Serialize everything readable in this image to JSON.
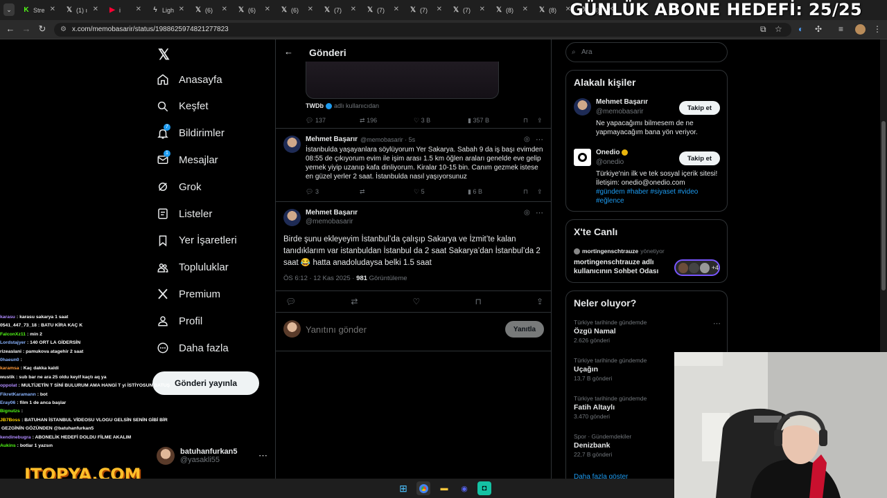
{
  "browser": {
    "tabs": [
      {
        "label": "Stre",
        "icon": "green-k-icon",
        "color": "#53fc18"
      },
      {
        "label": "(1) ı",
        "icon": "x-logo-icon"
      },
      {
        "label": "i",
        "icon": "youtube-icon",
        "color": "#ff0033"
      },
      {
        "label": "Ligh",
        "icon": "lightning-icon"
      },
      {
        "label": "(6)",
        "icon": "x-logo-icon"
      },
      {
        "label": "(6)",
        "icon": "x-logo-icon"
      },
      {
        "label": "(6)",
        "icon": "x-logo-icon"
      },
      {
        "label": "(7)",
        "icon": "x-logo-icon"
      },
      {
        "label": "(7)",
        "icon": "x-logo-icon"
      },
      {
        "label": "(7)",
        "icon": "x-logo-icon"
      },
      {
        "label": "(7)",
        "icon": "x-logo-icon"
      },
      {
        "label": "(8)",
        "icon": "x-logo-icon"
      },
      {
        "label": "(8)",
        "icon": "x-logo-icon"
      },
      {
        "label": "(8)",
        "icon": "x-logo-icon"
      }
    ],
    "url": "x.com/memobasarir/status/1988625974821277823"
  },
  "overlay": {
    "title": "GÜNLÜK ABONE HEDEFİ: 25/25",
    "brand": "ITOPYA.COM"
  },
  "sidebar": {
    "items": [
      {
        "label": "Anasayfa",
        "icon": "home-icon"
      },
      {
        "label": "Keşfet",
        "icon": "search-icon"
      },
      {
        "label": "Bildirimler",
        "icon": "bell-icon",
        "badge": "7"
      },
      {
        "label": "Mesajlar",
        "icon": "mail-icon",
        "badge": "1"
      },
      {
        "label": "Grok",
        "icon": "grok-icon"
      },
      {
        "label": "Listeler",
        "icon": "list-icon"
      },
      {
        "label": "Yer İşaretleri",
        "icon": "bookmark-icon"
      },
      {
        "label": "Topluluklar",
        "icon": "communities-icon"
      },
      {
        "label": "Premium",
        "icon": "x-logo-icon"
      },
      {
        "label": "Profil",
        "icon": "person-icon"
      },
      {
        "label": "Daha fazla",
        "icon": "more-circle-icon"
      }
    ],
    "post_button": "Gönderi yayınla",
    "account": {
      "name": "batuhanfurkan5",
      "handle": "@yasakli55"
    }
  },
  "main": {
    "header": "Gönderi",
    "top_tweet": {
      "source_name": "TWDb",
      "source_suffix": "adlı kullanıcıdan",
      "replies": "137",
      "retweets": "196",
      "likes": "3 B",
      "views": "357 B"
    },
    "reply_tweet": {
      "name": "Mehmet Başarır",
      "handle": "@memobasarir · 5s",
      "text": "İstanbulda yaşayanlara söylüyorum Yer Sakarya. Sabah 9 da iş başı evimden 08:55 de çıkıyorum evim ile işim arası 1.5 km öğlen araları genelde eve gelip yemek yiyip uzanıp kafa dinliyorum. Kiralar 10-15 bin. Canım gezmek istese en güzel yerler 2 saat. İstanbulda nasıl yaşıyorsunuz",
      "replies": "3",
      "retweets": "",
      "likes": "5",
      "views": "6 B"
    },
    "focus_tweet": {
      "name": "Mehmet Başarır",
      "handle": "@memobasarir",
      "text": "Birde şunu ekleyeyim İstanbul’da çalışıp Sakarya ve İzmit’te kalan tanıdıklarım var istanbuldan İstanbul da 2 saat Sakarya’dan İstanbul’da 2 saat 😂 hatta anadoludaysa belki 1.5 saat",
      "time": "ÖS 6:12 · 12 Kas 2025 ·",
      "views_count": "981",
      "views_label": "Görüntüleme"
    },
    "reply_placeholder": "Yanıtını gönder",
    "reply_button": "Yanıtla"
  },
  "right": {
    "search_placeholder": "Ara",
    "related": {
      "title": "Alakalı kişiler",
      "people": [
        {
          "name": "Mehmet Başarır",
          "handle": "@memobasarir",
          "bio": "Ne yapacağımı bilmesem de ne yapmayacağım bana yön veriyor.",
          "button": "Takip et"
        },
        {
          "name": "Onedio",
          "handle": "@onedio",
          "bio": "Türkiye'nin ilk ve tek sosyal içerik sitesi! İletişim: onedio@onedio.com",
          "hashtags": "#gündem #haber #siyaset #video #eğlence",
          "button": "Takip et"
        }
      ]
    },
    "live": {
      "title": "X'te Canlı",
      "host": "mortingenschtrauze",
      "host_suffix": "yönetiyor",
      "room": "mortingenschtrauze adlı kullanıcının Sohbet Odası",
      "extra": "+4"
    },
    "trends": {
      "title": "Neler oluyor?",
      "items": [
        {
          "category": "Türkiye tarihinde gündemde",
          "name": "Özgü Namal",
          "count": "2.626 gönderi"
        },
        {
          "category": "Türkiye tarihinde gündemde",
          "name": "Uçağın",
          "count": "13,7 B gönderi"
        },
        {
          "category": "Türkiye tarihinde gündemde",
          "name": "Fatih Altaylı",
          "count": "3.470 gönderi"
        },
        {
          "category": "Spor · Gündemdekiler",
          "name": "Denizbank",
          "count": "22,7 B gönderi"
        }
      ],
      "show_more": "Daha fazla göster"
    }
  },
  "chat": [
    {
      "user": "karasu",
      "msg": ": karasu sakarya 1 saat",
      "color": "#b08bff"
    },
    {
      "user": "0541_447_73_18",
      "msg": ": BATU KİRA KAÇ K",
      "color": "#ffffff"
    },
    {
      "user": "FalconXz11",
      "msg": ": min 2",
      "color": "#53fc18"
    },
    {
      "user": "Lordstajyer",
      "msg": ": 140 ORT LA GİDERSİN",
      "color": "#8ab4ff"
    },
    {
      "user": "rizeaslani",
      "msg": ": pamukova atagehir 2 saat",
      "color": "#ffffff"
    },
    {
      "user": "0haeun0",
      "msg": ":",
      "color": "#8ab4ff"
    },
    {
      "user": "karamsa",
      "msg": ": Kaç dakka kaldi",
      "color": "#ff9a3c"
    },
    {
      "user": "wustik",
      "msg": ": sub bar ne ara 25 oldu keyif kaçtı aq ya",
      "color": "#ffffff"
    },
    {
      "user": "oppolat",
      "msg": ": MULTİJETİN T SİNİ BULURUM AMA HANGİ T yi İSTİYOSUN BATUŞ",
      "color": "#b08bff"
    },
    {
      "user": "FikretKaramann",
      "msg": ": bot",
      "color": "#8ab4ff"
    },
    {
      "user": "Eray06",
      "msg": ": film 1 de anca başlar",
      "color": "#8ab4ff"
    },
    {
      "user": "Bignutzs",
      "msg": ":",
      "color": "#53fc18"
    },
    {
      "user": "JB7Boss",
      "msg": ": BATUHAN İSTANBUL VİDEOSU VLOGU GELSİN SENİN GİBİ BİR",
      "color": "#ffd400"
    },
    {
      "user": "",
      "msg": "GEZGİNİN GÖZÜNDEN @batuhanfurkan5",
      "color": "#ffffff"
    },
    {
      "user": "kendinebugra",
      "msg": ": ABONELİK HEDEFİ DOLDU FİLME AKALIM",
      "color": "#b08bff"
    },
    {
      "user": "Aukins",
      "msg": ": botlar 1 yazsın",
      "color": "#53fc18"
    }
  ]
}
